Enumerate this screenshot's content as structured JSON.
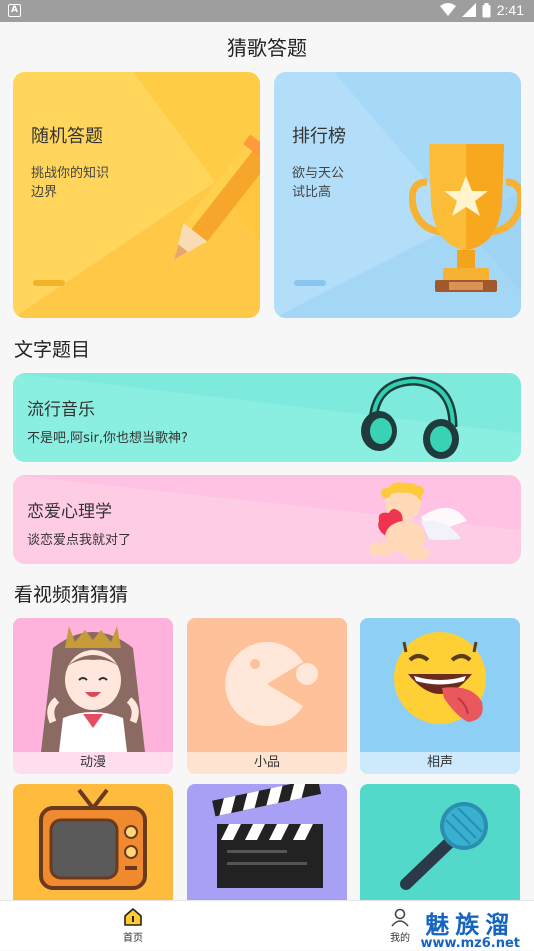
{
  "status_bar": {
    "time": "2:41"
  },
  "app": {
    "title": "猜歌答题"
  },
  "cards": {
    "random": {
      "title": "随机答题",
      "subtitle": "挑战你的知识边界"
    },
    "ranking": {
      "title": "排行榜",
      "subtitle": "欲与天公试比高"
    }
  },
  "sections": {
    "text": {
      "title": "文字题目"
    },
    "video": {
      "title": "看视频猜猜猜"
    }
  },
  "text_topics": [
    {
      "title": "流行音乐",
      "subtitle": "不是吧,阿sir,你也想当歌神?"
    },
    {
      "title": "恋爱心理学",
      "subtitle": "谈恋爱点我就对了"
    }
  ],
  "video_tiles": [
    {
      "label": "动漫",
      "color": "#ffb3dc"
    },
    {
      "label": "小品",
      "color": "#ffc19a"
    },
    {
      "label": "相声",
      "color": "#8ed0f5"
    }
  ],
  "bottom_nav": [
    {
      "label": "首页"
    },
    {
      "label": "我的"
    }
  ],
  "watermark": {
    "brand": "魅族溜",
    "url": "www.mz6.net"
  },
  "colors": {
    "card_random": "#ffcd45",
    "card_ranking": "#a6d8f7",
    "topic_music": "#7eeadd",
    "topic_love": "#ffc2e2",
    "tile_tv": "#ffbb3d",
    "tile_movie": "#a7a0f5",
    "tile_mic": "#53d9c9"
  }
}
